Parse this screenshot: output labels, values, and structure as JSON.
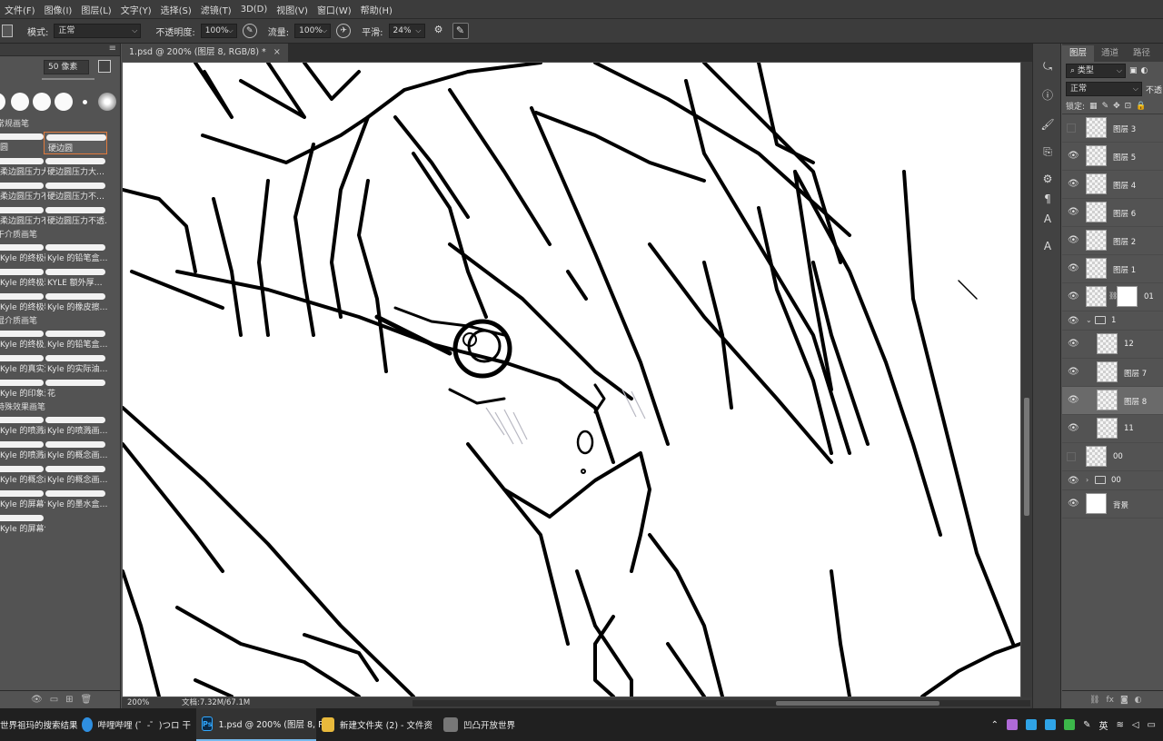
{
  "menu": [
    "文件(F)",
    "图像(I)",
    "图层(L)",
    "文字(Y)",
    "选择(S)",
    "滤镜(T)",
    "3D(D)",
    "视图(V)",
    "窗口(W)",
    "帮助(H)"
  ],
  "options": {
    "mode_label": "模式:",
    "mode_value": "正常",
    "opacity_label": "不透明度:",
    "opacity_value": "100%",
    "flow_label": "流量:",
    "flow_value": "100%",
    "smooth_label": "平滑:",
    "smooth_value": "24%"
  },
  "brush_panel": {
    "size_value": "50 像素",
    "groups": [
      {
        "name": "常规画笔",
        "rows": [
          [
            "圆",
            "硬边圆"
          ],
          [
            "柔边圆压力大…",
            "硬边圆压力大…"
          ],
          [
            "柔边圆压力不…",
            "硬边圆压力不…"
          ],
          [
            "柔边圆压力不透明度",
            "硬边圆压力不透…"
          ]
        ]
      },
      {
        "name": "干介质画笔",
        "rows": [
          [
            "Kyle 的终极硬…",
            "Kyle 的铅笔盒…"
          ],
          [
            "Kyle 的终极炭…",
            "KYLE 额外厚…"
          ],
          [
            "Kyle 的终极粉…",
            "Kyle 的橡皮擦…"
          ]
        ]
      },
      {
        "name": "湿介质画笔",
        "rows": [
          [
            "Kyle 的终极上…",
            "Kyle 的铅笔盒…"
          ],
          [
            "Kyle 的真实油…",
            "Kyle 的实际油…"
          ],
          [
            "Kyle 的印象派…",
            "花"
          ]
        ]
      },
      {
        "name": "特殊效果画笔",
        "rows": [
          [
            "Kyle 的喷溅画…",
            "Kyle 的喷溅画…"
          ],
          [
            "Kyle 的喷溅画…",
            "Kyle 的概念画…"
          ],
          [
            "Kyle 的概念画…",
            "Kyle 的概念画…"
          ],
          [
            "Kyle 的屏幕色…",
            "Kyle 的墨水盒…"
          ],
          [
            "Kyle 的屏幕色…",
            ""
          ]
        ]
      }
    ]
  },
  "document": {
    "tab_title": "1.psd @ 200% (图层 8, RGB/8) *",
    "tab_close": "×",
    "status_zoom": "200%",
    "status_doc": "文档:7.32M/67.1M"
  },
  "layers_panel": {
    "tabs": [
      "图层",
      "通道",
      "路径"
    ],
    "filter_label": "类型",
    "blend_mode": "正常",
    "opacity_short": "不透",
    "lock_label": "锁定:",
    "layers": [
      {
        "name": "图层 3",
        "visible": false,
        "kind": "layer",
        "indent": false
      },
      {
        "name": "图层 5",
        "visible": true,
        "kind": "layer",
        "indent": false
      },
      {
        "name": "图层 4",
        "visible": true,
        "kind": "layer",
        "indent": false
      },
      {
        "name": "图层 6",
        "visible": true,
        "kind": "layer",
        "indent": false
      },
      {
        "name": "图层 2",
        "visible": true,
        "kind": "layer",
        "indent": false
      },
      {
        "name": "图层 1",
        "visible": true,
        "kind": "layer",
        "indent": false
      },
      {
        "name": "01",
        "visible": true,
        "kind": "masked",
        "indent": false
      },
      {
        "name": "1",
        "visible": true,
        "kind": "folder-open",
        "indent": false
      },
      {
        "name": "12",
        "visible": true,
        "kind": "layer",
        "indent": true
      },
      {
        "name": "图层 7",
        "visible": true,
        "kind": "layer",
        "indent": true
      },
      {
        "name": "图层 8",
        "visible": true,
        "kind": "layer",
        "indent": true,
        "selected": true
      },
      {
        "name": "11",
        "visible": true,
        "kind": "layer",
        "indent": true
      },
      {
        "name": "00",
        "visible": false,
        "kind": "layer",
        "indent": false
      },
      {
        "name": "00",
        "visible": true,
        "kind": "folder",
        "indent": false
      },
      {
        "name": "背景",
        "visible": true,
        "kind": "white",
        "indent": false
      }
    ]
  },
  "taskbar": {
    "items": [
      {
        "label": "世界祖玛的搜索结果",
        "icon": "browser-icon"
      },
      {
        "label": "哔哩哔哩 (゜-゜)つロ 干",
        "icon": "bilibili-icon"
      },
      {
        "label": "1.psd @ 200% (图层 8, R",
        "icon": "photoshop-icon",
        "active": true
      },
      {
        "label": "新建文件夹 (2) - 文件资",
        "icon": "folder-icon"
      },
      {
        "label": "凹凸开放世界",
        "icon": "game-icon"
      }
    ],
    "ime": "英",
    "ps_label": "Ps"
  },
  "colors": {
    "accent": "#e07a3c",
    "taskbar_active": "#76b9ed"
  }
}
